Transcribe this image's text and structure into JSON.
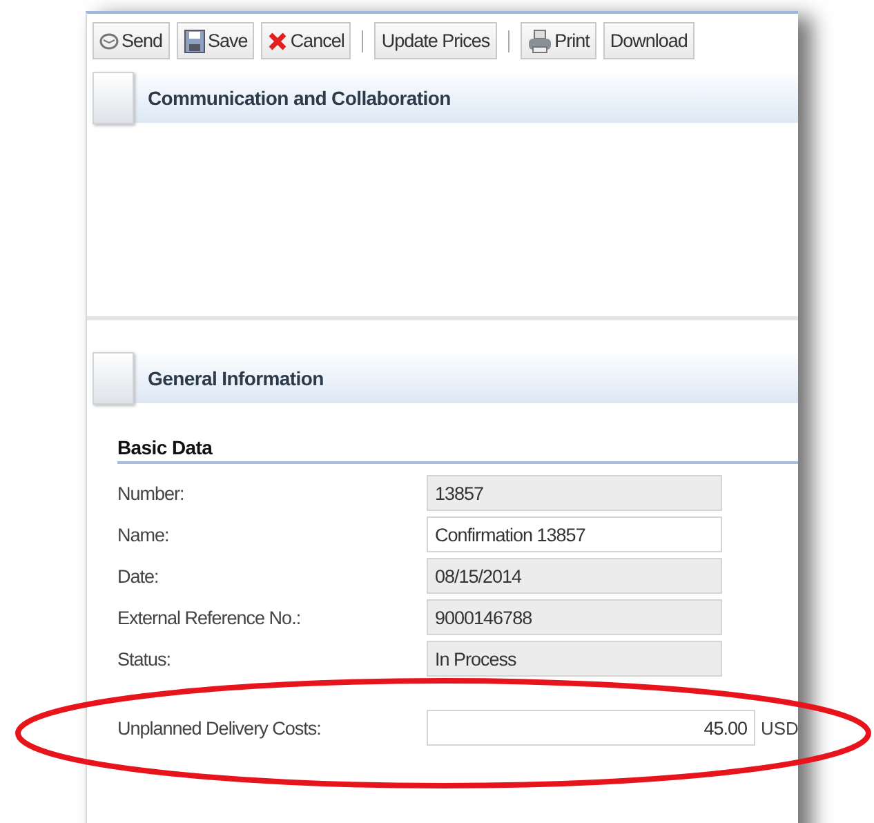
{
  "toolbar": {
    "groups": [
      [
        {
          "label": "Send",
          "kind": "send"
        },
        {
          "label": "Save",
          "kind": "save"
        },
        {
          "label": "Cancel",
          "kind": "cancel"
        }
      ],
      [
        {
          "label": "Update Prices",
          "kind": "plain"
        }
      ],
      [
        {
          "label": "Print",
          "kind": "print"
        },
        {
          "label": "Download",
          "kind": "plain"
        }
      ]
    ]
  },
  "communication_section": {
    "title": "Communication and Collaboration"
  },
  "general_section": {
    "title": "General Information",
    "subsection": "Basic Data",
    "fields": [
      {
        "label": "Number:",
        "value": "13857",
        "editable": false
      },
      {
        "label": "Name:",
        "value": "Confirmation 13857",
        "editable": true
      },
      {
        "label": "Date:",
        "value": "08/15/2014",
        "editable": false
      },
      {
        "label": "External Reference No.:",
        "value": "9000146788",
        "editable": false
      },
      {
        "label": "Status:",
        "value": "In Process",
        "editable": false
      }
    ],
    "cost_field": {
      "label": "Unplanned Delivery Costs:",
      "value": "45.00",
      "unit": "USD",
      "highlighted": true
    }
  }
}
